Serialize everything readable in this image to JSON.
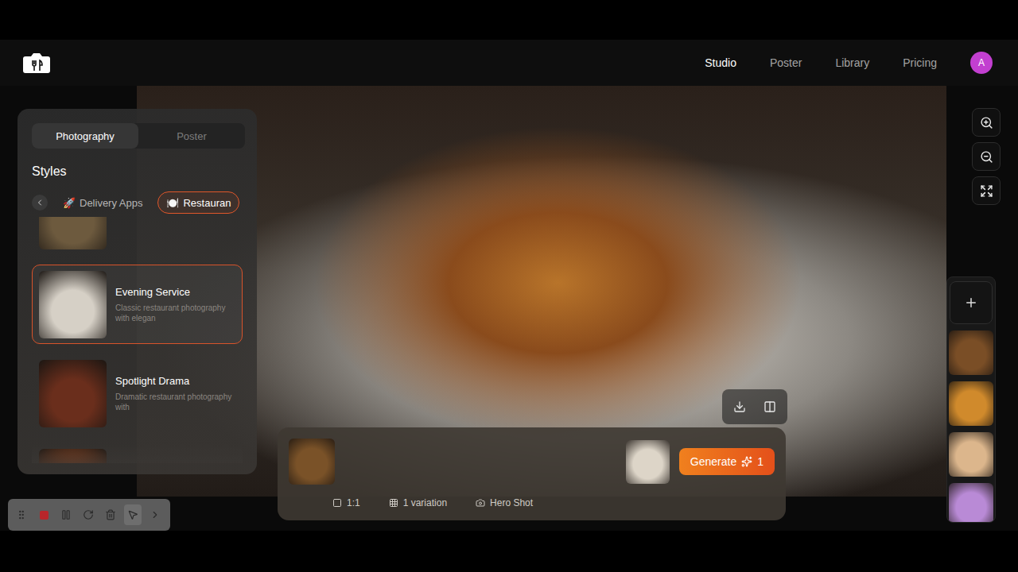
{
  "nav": [
    {
      "label": "Studio",
      "selected": true
    },
    {
      "label": "Poster",
      "selected": false
    },
    {
      "label": "Library",
      "selected": false
    },
    {
      "label": "Pricing",
      "selected": false
    }
  ],
  "avatar": {
    "initial": "A"
  },
  "panel": {
    "tabs": [
      {
        "label": "Photography",
        "selected": true
      },
      {
        "label": "Poster",
        "selected": false
      }
    ],
    "title": "Styles",
    "chips": [
      {
        "emoji": "🚀",
        "label": "Delivery Apps",
        "selected": false
      },
      {
        "emoji": "🍽️",
        "label": "Restauran",
        "selected": true
      }
    ],
    "styles": [
      {
        "kind": "image-only",
        "selected": false,
        "color": "#6d5a3e"
      },
      {
        "kind": "full",
        "name": "Evening Service",
        "description": "Classic restaurant photography with elegan",
        "selected": true,
        "color": "#d6d0c6"
      },
      {
        "kind": "full",
        "name": "Spotlight Drama",
        "description": "Dramatic restaurant photography with",
        "selected": false,
        "color": "#6a2e1c"
      },
      {
        "kind": "image-only",
        "selected": false,
        "color": "#a0461a"
      }
    ]
  },
  "prompt": {
    "image_color": "#7a5228",
    "reference_color": "#ddd5c8",
    "generate": "Generate",
    "credits": "1",
    "options": [
      {
        "kind": "ratio",
        "label": "1:1"
      },
      {
        "kind": "variations",
        "label": "1 variation"
      },
      {
        "kind": "shot",
        "label": "Hero Shot"
      }
    ]
  },
  "thumbnails": [
    {
      "color": "#7a4e26"
    },
    {
      "color": "#d08a2c"
    },
    {
      "color": "#dcb68c"
    },
    {
      "color": "#b98ad6"
    }
  ],
  "recorder": {
    "recording": true
  }
}
